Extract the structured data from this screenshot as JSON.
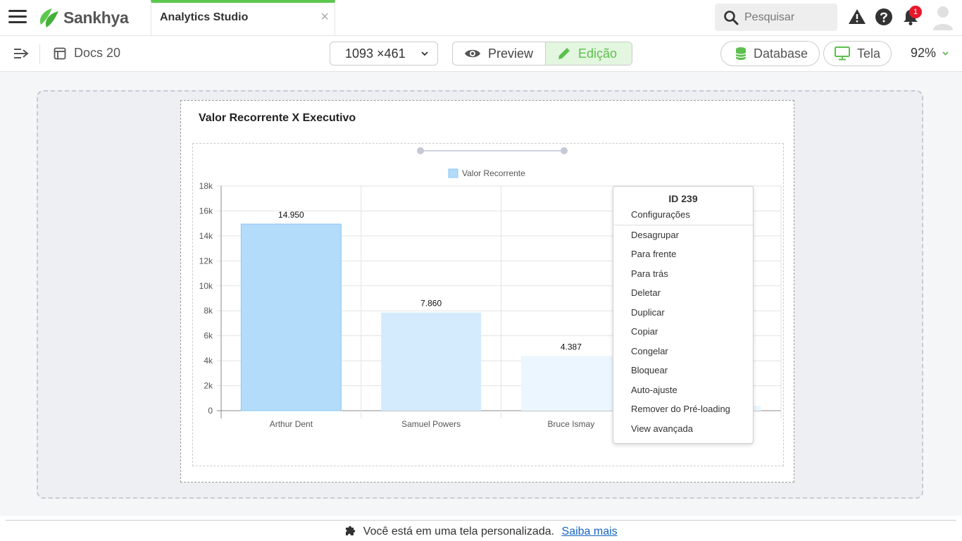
{
  "header": {
    "brand": "Sankhya",
    "app_tab": "Analytics Studio",
    "close_glyph": "×",
    "search_placeholder": "Pesquisar",
    "notification_count": "1",
    "icons": [
      "menu-icon",
      "search-icon",
      "warning-icon",
      "help-icon",
      "bell-icon",
      "user-icon"
    ],
    "accent_color": "#5cc74e"
  },
  "toolbar": {
    "doc_title": "Docs 20",
    "size": "1093 ×461",
    "preview_label": "Preview",
    "edit_label": "Edição",
    "database_label": "Database",
    "tela_label": "Tela",
    "zoom": "92%"
  },
  "card": {
    "title": "Valor Recorrente X Executivo"
  },
  "chart_data": {
    "type": "bar",
    "title": "Valor Recorrente X Executivo",
    "categories": [
      "Arthur Dent",
      "Samuel Powers",
      "Bruce Ismay",
      ""
    ],
    "series": [
      {
        "name": "Valor Recorrente",
        "values": [
          14950,
          7860,
          4387,
          400
        ]
      }
    ],
    "data_labels": [
      "14.950",
      "7.860",
      "4.387",
      ""
    ],
    "bar_colors": [
      "#b3dcfa",
      "#d3ebfc",
      "#ebf6fe",
      "#ebf6fe"
    ],
    "bar_stroke": "#8cc7f2",
    "ylim": [
      0,
      18000
    ],
    "yticks": [
      0,
      2000,
      4000,
      6000,
      8000,
      10000,
      12000,
      14000,
      16000,
      18000
    ],
    "ytick_labels": [
      "0",
      "2k",
      "4k",
      "6k",
      "8k",
      "10k",
      "12k",
      "14k",
      "16k",
      "18k"
    ],
    "xlabel": "",
    "ylabel": "",
    "grid": true,
    "legend": "top-center"
  },
  "context_menu": {
    "id_label": "ID 239",
    "items": [
      "Configurações",
      "Desagrupar",
      "Para frente",
      "Para trás",
      "Deletar",
      "Duplicar",
      "Copiar",
      "Congelar",
      "Bloquear",
      "Auto-ajuste",
      "Remover do Pré-loading",
      "View avançada"
    ]
  },
  "footer": {
    "text": "Você está em uma tela personalizada.",
    "link": "Saiba mais"
  }
}
